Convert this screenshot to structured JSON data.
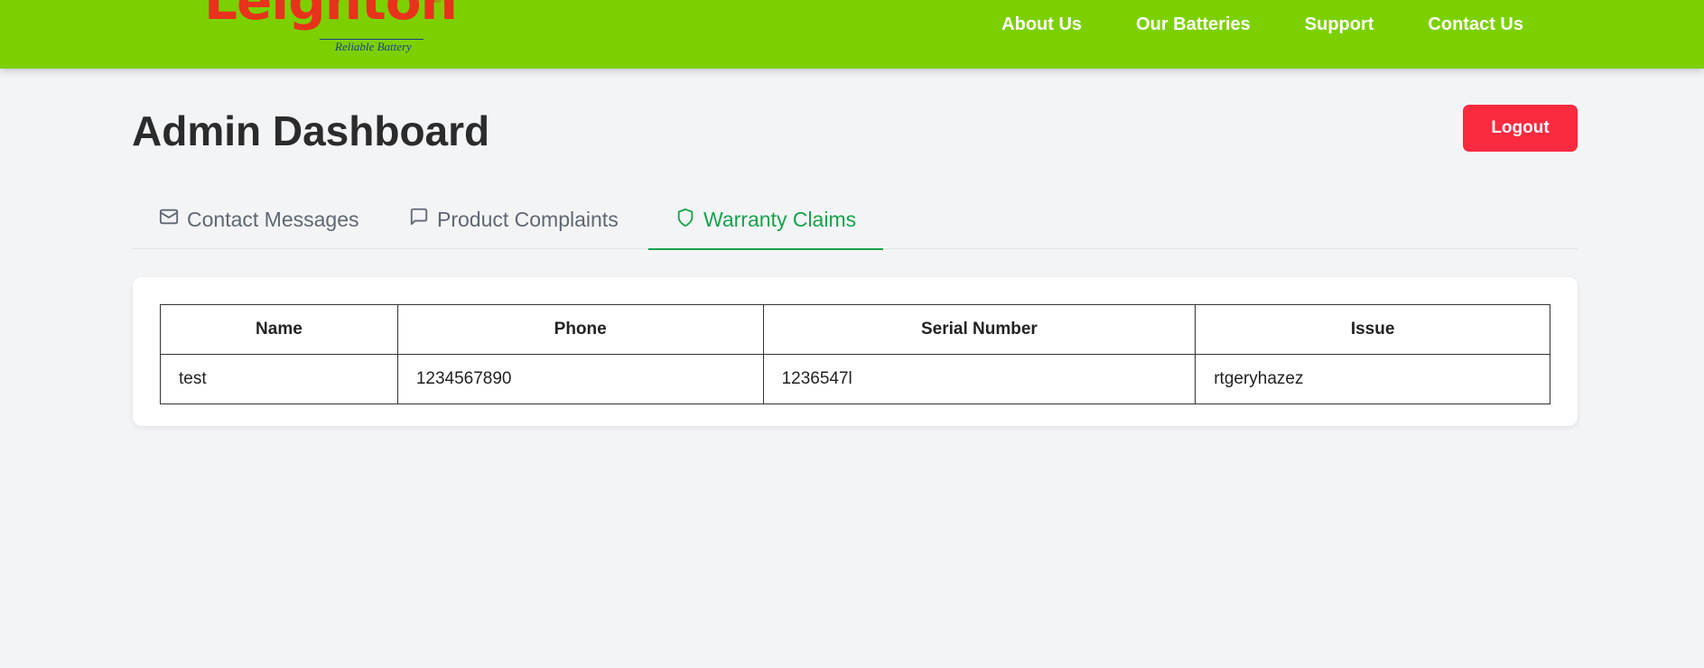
{
  "brand": {
    "name": "Leighton",
    "registered_mark": "®",
    "tagline": "Reliable Battery",
    "color": "#e8321c"
  },
  "navbar": {
    "background": "#7cd000",
    "links": [
      "About Us",
      "Our Batteries",
      "Support",
      "Contact Us"
    ]
  },
  "page": {
    "title": "Admin Dashboard",
    "logout_label": "Logout"
  },
  "tabs": [
    {
      "label": "Contact Messages",
      "icon": "mail-icon",
      "active": false
    },
    {
      "label": "Product Complaints",
      "icon": "message-square-icon",
      "active": false
    },
    {
      "label": "Warranty Claims",
      "icon": "shield-icon",
      "active": true
    }
  ],
  "table": {
    "headers": [
      "Name",
      "Phone",
      "Serial Number",
      "Issue"
    ],
    "rows": [
      [
        "test",
        "1234567890",
        "1236547l",
        "rtgeryhazez"
      ]
    ]
  },
  "colors": {
    "accent": "#16a34a",
    "danger": "#fa2a3f"
  }
}
